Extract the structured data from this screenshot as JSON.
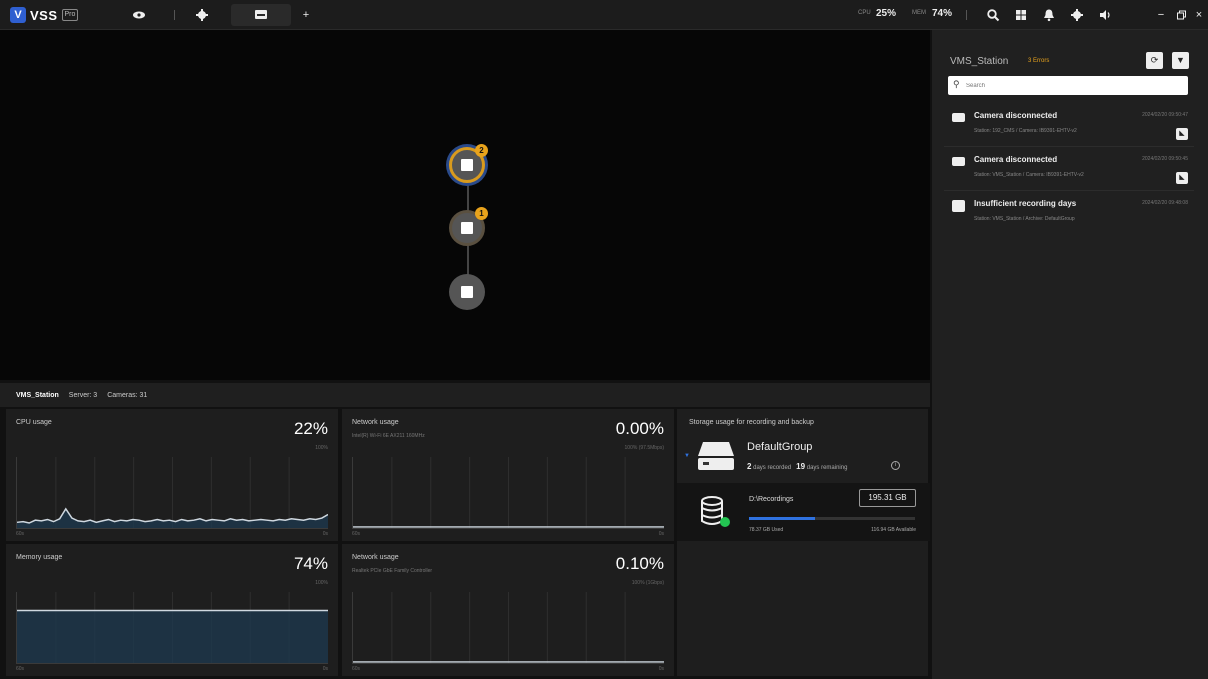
{
  "app": {
    "logo_text": "VSS",
    "logo_badge": "Pro"
  },
  "topbar": {
    "cpu_label": "CPU",
    "cpu_value": "25%",
    "mem_label": "MEM",
    "mem_value": "74%",
    "icons": [
      "eye-icon",
      "gear-icon",
      "monitor-icon",
      "plus-icon",
      "search-icon",
      "grid-icon",
      "bell-icon",
      "settings-icon",
      "volume-icon",
      "minimize-icon",
      "restore-icon",
      "close-icon"
    ]
  },
  "topology": {
    "nodes": [
      {
        "badge": "2",
        "status": "error"
      },
      {
        "badge": "1",
        "status": "warning"
      },
      {
        "badge": "",
        "status": "normal"
      }
    ]
  },
  "station_bar": {
    "name": "VMS_Station",
    "servers": "Server: 3",
    "cameras": "Cameras: 31"
  },
  "panels": {
    "cpu": {
      "title": "CPU usage",
      "value": "22%",
      "max": "100%",
      "x_start": "60s",
      "x_end": "0s",
      "series": [
        8,
        9,
        7,
        11,
        10,
        12,
        9,
        13,
        27,
        14,
        10,
        9,
        11,
        8,
        10,
        12,
        9,
        11,
        10,
        12,
        11,
        9,
        10,
        12,
        10,
        11,
        9,
        12,
        10,
        11,
        13,
        10,
        12,
        11,
        10,
        13,
        11,
        12,
        10,
        11,
        12,
        11,
        10,
        12,
        11,
        13,
        12,
        11,
        13,
        12,
        14,
        19
      ]
    },
    "net1": {
      "title": "Network usage",
      "adapter": "Intel(R) Wi-Fi 6E AX211 160MHz",
      "value": "0.00%",
      "max": "100% (97.5Mbps)",
      "x_start": "60s",
      "x_end": "0s",
      "level": 0
    },
    "mem": {
      "title": "Memory usage",
      "value": "74%",
      "max": "100%",
      "x_start": "60s",
      "x_end": "0s",
      "level": 74
    },
    "net2": {
      "title": "Network usage",
      "adapter": "Realtek PCIe GbE Family Controller",
      "value": "0.10%",
      "max": "100% (1Gbps)",
      "x_start": "60s",
      "x_end": "0s",
      "level": 0.1
    },
    "storage": {
      "title": "Storage usage for recording and backup",
      "group_name": "DefaultGroup",
      "days_recorded_num": "2",
      "days_recorded_label": "days recorded",
      "days_remaining_num": "19",
      "days_remaining_label": "days remaining",
      "disk_name": "D:\\Recordings",
      "disk_size": "195.31 GB",
      "used": "78.37 GB Used",
      "available": "116.94 GB Available",
      "used_fraction": 0.4
    }
  },
  "side": {
    "title": "VMS_Station",
    "errors": "3 Errors",
    "search_placeholder": "Search",
    "alerts": [
      {
        "title": "Camera disconnected",
        "time": "2024/02/20 09:50:47",
        "sub": "Station: 192_CMS / Camera: IB9391-EHTV-v2",
        "icon": "camera-icon",
        "action": true
      },
      {
        "title": "Camera disconnected",
        "time": "2024/02/20 09:50:45",
        "sub": "Station: VMS_Station / Camera: IB9391-EHTV-v2",
        "icon": "camera-icon",
        "action": true
      },
      {
        "title": "Insufficient recording days",
        "time": "2024/02/20 09:48:08",
        "sub": "Station: VMS_Station / Archive: DefaultGroup",
        "icon": "storage-icon",
        "action": false
      }
    ]
  },
  "colors": {
    "accent": "#2f72e0",
    "warning": "#e8a31c",
    "online": "#23c552"
  }
}
